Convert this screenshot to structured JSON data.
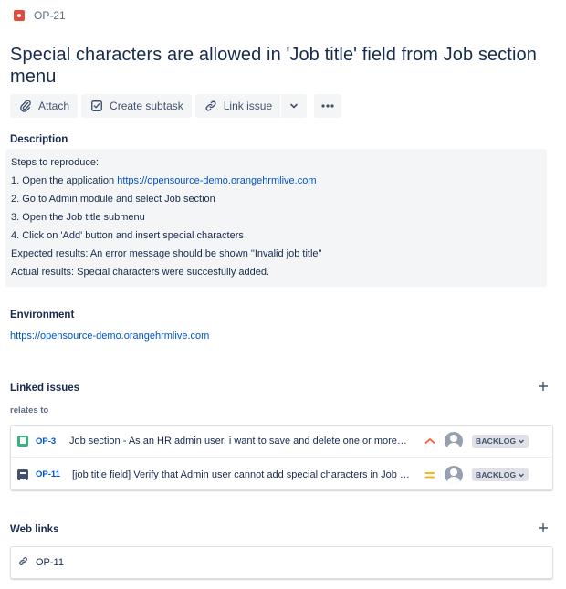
{
  "issue": {
    "key": "OP-21",
    "title": "Special characters are allowed in 'Job title' field from Job section menu"
  },
  "toolbar": {
    "attach_label": "Attach",
    "create_subtask_label": "Create subtask",
    "link_issue_label": "Link issue"
  },
  "description": {
    "label": "Description",
    "steps_heading": "Steps to reproduce:",
    "step1_text": "1. Open the application ",
    "step1_link": "https://opensource-demo.orangehrmlive.com",
    "step2": "2. Go to Admin module and select Job section",
    "step3": "3. Open the Job title submenu",
    "step4": "4. Click on 'Add' button and insert special characters",
    "expected": "Expected results: An error message should be shown \"Invalid job title\"",
    "actual": "Actual results: Special characters were succesfully added."
  },
  "environment": {
    "label": "Environment",
    "link": "https://opensource-demo.orangehrmlive.com"
  },
  "linked_issues": {
    "label": "Linked issues",
    "relation": "relates to",
    "items": [
      {
        "key": "OP-3",
        "summary": "Job section - As an HR admin user, i want to save and delete one or more job titles",
        "status": "BACKLOG",
        "priority": "high"
      },
      {
        "key": "OP-11",
        "summary": "[job title field] Verify that Admin user cannot add special characters in Job title field",
        "status": "BACKLOG",
        "priority": "medium"
      }
    ]
  },
  "web_links": {
    "label": "Web links",
    "items": [
      {
        "text": "OP-11"
      }
    ]
  },
  "colors": {
    "link": "#0052cc",
    "bug": "#e5493a",
    "story": "#36b37e",
    "priority_high": "#ff5630",
    "priority_medium": "#ffab00"
  }
}
